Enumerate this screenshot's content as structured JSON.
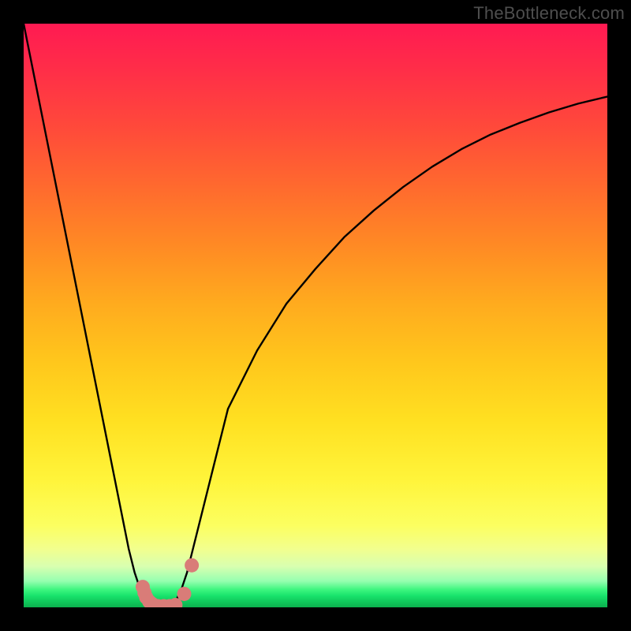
{
  "watermark": "TheBottleneck.com",
  "chart_data": {
    "type": "line",
    "title": "",
    "xlabel": "",
    "ylabel": "",
    "xlim": [
      0,
      100
    ],
    "ylim": [
      0,
      100
    ],
    "x": [
      0,
      1,
      2,
      3,
      4,
      5,
      6,
      7,
      8,
      9,
      10,
      11,
      12,
      13,
      14,
      15,
      16,
      17,
      18,
      19,
      20,
      21,
      22,
      23,
      24,
      25,
      26,
      27,
      28,
      29,
      30,
      31,
      32,
      33,
      34,
      35,
      40,
      45,
      50,
      55,
      60,
      65,
      70,
      75,
      80,
      85,
      90,
      95,
      100
    ],
    "y": [
      100,
      95,
      90,
      85,
      80,
      75,
      70,
      65,
      60,
      55,
      50,
      45,
      40,
      35,
      30,
      25,
      20,
      15,
      10,
      6,
      3,
      1,
      0,
      0,
      0,
      0,
      1,
      3,
      6,
      10,
      14,
      18,
      22,
      26,
      30,
      34,
      44,
      52,
      58,
      63.5,
      68,
      72,
      75.5,
      78.5,
      81,
      83,
      84.8,
      86.3,
      87.5
    ],
    "markers": {
      "x": [
        20.4,
        20.7,
        21.0,
        21.5,
        22.0,
        22.5,
        23.0,
        24.0,
        25.0,
        26.0,
        27.5,
        28.8
      ],
      "y": [
        3.5,
        2.5,
        1.7,
        1.0,
        0.6,
        0.3,
        0.2,
        0.2,
        0.2,
        0.4,
        2.3,
        7.2
      ]
    },
    "marker_style": {
      "color": "#d97c78",
      "radius": 9
    }
  },
  "colors": {
    "gradient_top": "#ff1a52",
    "gradient_mid": "#ffe021",
    "gradient_bottom": "#0cb14e",
    "curve": "#000000",
    "marker": "#d97c78",
    "frame": "#000000",
    "watermark": "#4e4e4e"
  }
}
